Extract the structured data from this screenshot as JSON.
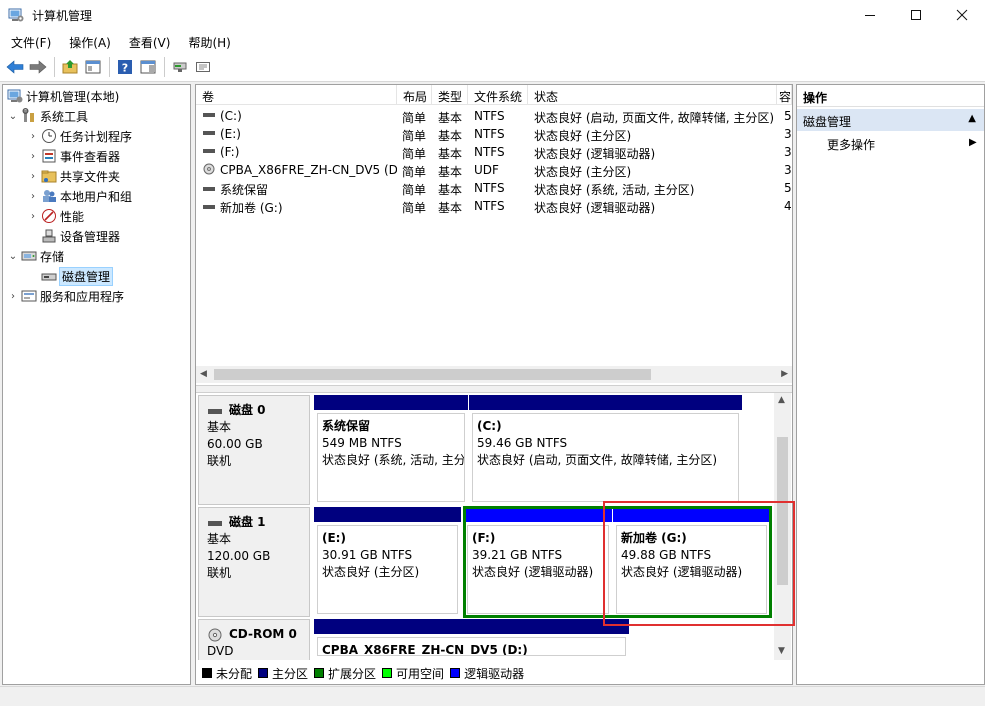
{
  "window": {
    "title": "计算机管理"
  },
  "menu": [
    "文件(F)",
    "操作(A)",
    "查看(V)",
    "帮助(H)"
  ],
  "tree": {
    "root": "计算机管理(本地)",
    "system_tools": "系统工具",
    "task_scheduler": "任务计划程序",
    "event_viewer": "事件查看器",
    "shared_folders": "共享文件夹",
    "local_users": "本地用户和组",
    "performance": "性能",
    "device_manager": "设备管理器",
    "storage": "存储",
    "disk_management": "磁盘管理",
    "services_apps": "服务和应用程序"
  },
  "list": {
    "headers": {
      "volume": "卷",
      "layout": "布局",
      "type": "类型",
      "fs": "文件系统",
      "status": "状态",
      "extra": "容"
    },
    "rows": [
      {
        "volume": "(C:)",
        "layout": "简单",
        "type": "基本",
        "fs": "NTFS",
        "status": "状态良好 (启动, 页面文件, 故障转储, 主分区)",
        "extra": "5"
      },
      {
        "volume": "(E:)",
        "layout": "简单",
        "type": "基本",
        "fs": "NTFS",
        "status": "状态良好 (主分区)",
        "extra": "3"
      },
      {
        "volume": "(F:)",
        "layout": "简单",
        "type": "基本",
        "fs": "NTFS",
        "status": "状态良好 (逻辑驱动器)",
        "extra": "3"
      },
      {
        "volume": "CPBA_X86FRE_ZH-CN_DV5 (D:)",
        "layout": "简单",
        "type": "基本",
        "fs": "UDF",
        "status": "状态良好 (主分区)",
        "extra": "3"
      },
      {
        "volume": "系统保留",
        "layout": "简单",
        "type": "基本",
        "fs": "NTFS",
        "status": "状态良好 (系统, 活动, 主分区)",
        "extra": "5"
      },
      {
        "volume": "新加卷 (G:)",
        "layout": "简单",
        "type": "基本",
        "fs": "NTFS",
        "status": "状态良好 (逻辑驱动器)",
        "extra": "4"
      }
    ]
  },
  "disks": [
    {
      "name": "磁盘 0",
      "type": "基本",
      "size": "60.00 GB",
      "state": "联机",
      "partitions": [
        {
          "name": "系统保留",
          "size": "549 MB NTFS",
          "status": "状态良好 (系统, 活动, 主分",
          "bar": "#00007f"
        },
        {
          "name": "(C:)",
          "size": "59.46 GB NTFS",
          "status": "状态良好 (启动, 页面文件, 故障转储, 主分区)",
          "bar": "#00007f"
        }
      ]
    },
    {
      "name": "磁盘 1",
      "type": "基本",
      "size": "120.00 GB",
      "state": "联机",
      "partitions": [
        {
          "name": "(E:)",
          "size": "30.91 GB NTFS",
          "status": "状态良好 (主分区)",
          "bar": "#00007f"
        },
        {
          "name": "(F:)",
          "size": "39.21 GB NTFS",
          "status": "状态良好 (逻辑驱动器)",
          "bar": "#0000ff"
        },
        {
          "name": "新加卷  (G:)",
          "size": "49.88 GB NTFS",
          "status": "状态良好 (逻辑驱动器)",
          "bar": "#0000ff"
        }
      ]
    },
    {
      "name": "CD-ROM 0",
      "type": "DVD",
      "partitions": [
        {
          "name": "CPBA_X86FRE_ZH-CN_DV5  (D:)",
          "bar": "#00007f"
        }
      ]
    }
  ],
  "legend": [
    {
      "label": "未分配",
      "color": "#000000"
    },
    {
      "label": "主分区",
      "color": "#00007f"
    },
    {
      "label": "扩展分区",
      "color": "#008000"
    },
    {
      "label": "可用空间",
      "color": "#00ff00"
    },
    {
      "label": "逻辑驱动器",
      "color": "#0000ff"
    }
  ],
  "actions": {
    "header": "操作",
    "section": "磁盘管理",
    "more": "更多操作"
  }
}
